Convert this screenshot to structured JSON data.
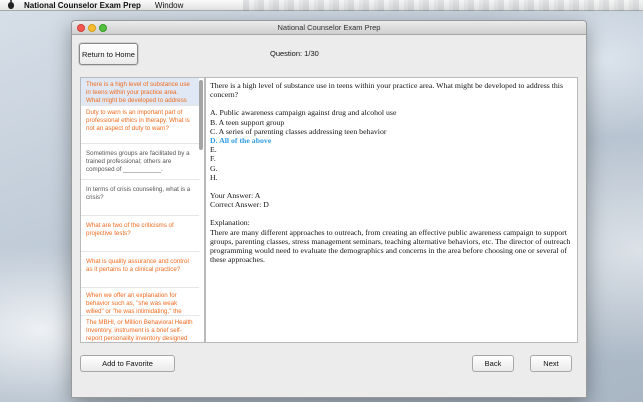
{
  "menubar": {
    "app_name": "National Counselor Exam Prep",
    "items": [
      "Window"
    ]
  },
  "window": {
    "title": "National Counselor Exam Prep"
  },
  "toolbar": {
    "home_label": "Return to Home",
    "question_label": "Question:  1/30"
  },
  "sidebar": {
    "items": [
      {
        "text": "There is a high level of substance use in teens within your practice area. What might be developed to address this concern?",
        "style": "orange",
        "selected": true
      },
      {
        "text": "Duty to warn is an important part of professional ethics in therapy. What is not an aspect of duty to warn?",
        "style": "orange",
        "selected": false
      },
      {
        "text": "Sometimes groups are facilitated by a trained professional; others are composed of ___________.",
        "style": "gray",
        "selected": false
      },
      {
        "text": "In terms of crisis counseling, what is a crisis?",
        "style": "gray",
        "selected": false
      },
      {
        "text": "What are two of the criticisms of projective tests?",
        "style": "orange",
        "selected": false
      },
      {
        "text": "What is quality assurance and control as it pertains to a clinical practice?",
        "style": "orange",
        "selected": false
      },
      {
        "text": "When we offer an explanation for behavior such as, \"she was weak willed\" or \"he was intimidating,\" the term __________ is used.",
        "style": "orange",
        "selected": false
      },
      {
        "text": "The MBHI, or Million Behavioral Health Inventory, instrument is a brief self-report personality inventory designed to help the clinician assess the",
        "style": "orange",
        "selected": false
      }
    ]
  },
  "main": {
    "question": "There is a high level of substance use in teens within your practice area. What might be developed to address this concern?",
    "options": [
      {
        "text": "A. Public awareness campaign against drug and alcohol use",
        "correct": false
      },
      {
        "text": "B. A teen support group",
        "correct": false
      },
      {
        "text": "C. A series of parenting classes addressing teen behavior",
        "correct": false
      },
      {
        "text": "D. All of the above",
        "correct": true
      },
      {
        "text": "E.",
        "correct": false
      },
      {
        "text": "F.",
        "correct": false
      },
      {
        "text": "G.",
        "correct": false
      },
      {
        "text": "H.",
        "correct": false
      }
    ],
    "your_answer": "Your Answer: A",
    "correct_answer": "Correct Answer: D",
    "explanation_label": "Explanation:",
    "explanation": "There are many different approaches to outreach, from creating an effective public awareness campaign to support groups, parenting classes, stress management seminars, teaching alternative behaviors, etc. The director of outreach programming would need to evaluate the demographics and concerns in the area before choosing one or several of these approaches."
  },
  "footer": {
    "favorite_label": "Add to Favorite",
    "back_label": "Back",
    "next_label": "Next"
  },
  "colors": {
    "orange_text": "#ef6b1f",
    "correct_blue": "#2f9be6",
    "selected_row": "#dfe8f4"
  }
}
